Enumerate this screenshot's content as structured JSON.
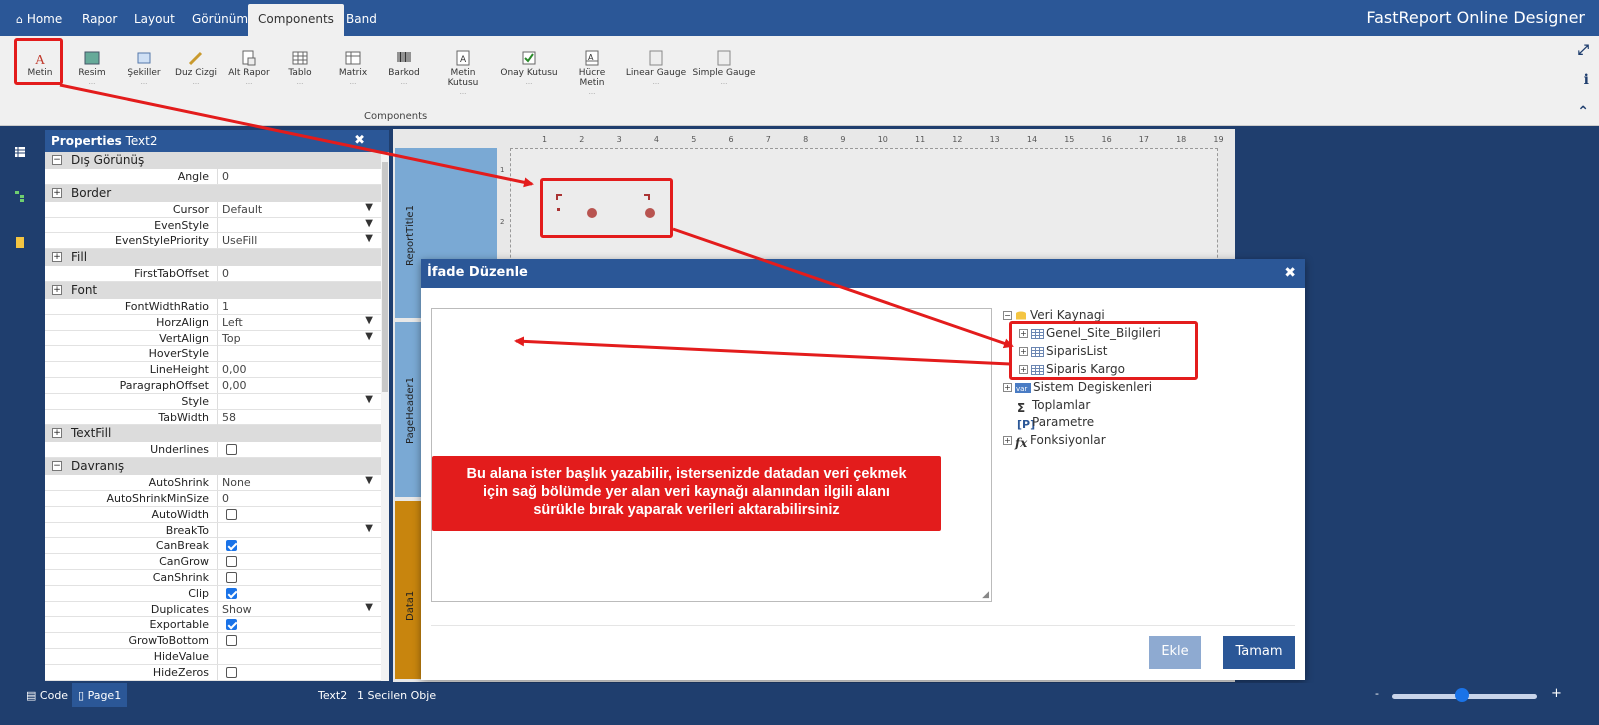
{
  "topbar": {
    "tabs": [
      {
        "label": "Home",
        "icon": "home-icon"
      },
      {
        "label": "Rapor"
      },
      {
        "label": "Layout"
      },
      {
        "label": "Görünüm"
      },
      {
        "label": "Components"
      },
      {
        "label": "Band"
      }
    ],
    "active_tab": "Components",
    "app_title": "FastReport Online Designer"
  },
  "ribbon": {
    "group_label": "Components",
    "items": [
      {
        "label": "Metin",
        "icon": "text-icon"
      },
      {
        "label": "Resim",
        "icon": "picture-icon"
      },
      {
        "label": "Şekiller",
        "icon": "shape-icon"
      },
      {
        "label": "Duz Cizgi",
        "icon": "line-icon"
      },
      {
        "label": "Alt Rapor",
        "icon": "subreport-icon"
      },
      {
        "label": "Tablo",
        "icon": "table-icon"
      },
      {
        "label": "Matrix",
        "icon": "matrix-icon"
      },
      {
        "label": "Barkod",
        "icon": "barcode-icon"
      },
      {
        "label": "Metin Kutusu",
        "icon": "textbox-icon"
      },
      {
        "label": "Onay Kutusu",
        "icon": "checkbox-icon"
      },
      {
        "label": "Hücre Metin",
        "icon": "cell-text-icon"
      },
      {
        "label": "Linear Gauge",
        "icon": "linear-gauge-icon"
      },
      {
        "label": "Simple Gauge",
        "icon": "simple-gauge-icon"
      }
    ],
    "dots": "..."
  },
  "properties": {
    "title": "Properties",
    "object": "Text2",
    "rows": [
      {
        "type": "cat",
        "label": "Dış Görünüş",
        "toggle": "−"
      },
      {
        "type": "prop",
        "name": "Angle",
        "value": "0"
      },
      {
        "type": "cat",
        "label": "Border",
        "toggle": "+"
      },
      {
        "type": "prop",
        "name": "Cursor",
        "value": "Default",
        "dropdown": true
      },
      {
        "type": "prop",
        "name": "EvenStyle",
        "value": "",
        "dropdown": true
      },
      {
        "type": "prop",
        "name": "EvenStylePriority",
        "value": "UseFill",
        "dropdown": true
      },
      {
        "type": "cat",
        "label": "Fill",
        "toggle": "+"
      },
      {
        "type": "prop",
        "name": "FirstTabOffset",
        "value": "0"
      },
      {
        "type": "cat",
        "label": "Font",
        "toggle": "+"
      },
      {
        "type": "prop",
        "name": "FontWidthRatio",
        "value": "1"
      },
      {
        "type": "prop",
        "name": "HorzAlign",
        "value": "Left",
        "dropdown": true
      },
      {
        "type": "prop",
        "name": "VertAlign",
        "value": "Top",
        "dropdown": true
      },
      {
        "type": "prop",
        "name": "HoverStyle",
        "value": ""
      },
      {
        "type": "prop",
        "name": "LineHeight",
        "value": "0,00"
      },
      {
        "type": "prop",
        "name": "ParagraphOffset",
        "value": "0,00"
      },
      {
        "type": "prop",
        "name": "Style",
        "value": "",
        "dropdown": true
      },
      {
        "type": "prop",
        "name": "TabWidth",
        "value": "58"
      },
      {
        "type": "cat",
        "label": "TextFill",
        "toggle": "+"
      },
      {
        "type": "prop",
        "name": "Underlines",
        "checkbox": false
      },
      {
        "type": "cat",
        "label": "Davranış",
        "toggle": "−"
      },
      {
        "type": "prop",
        "name": "AutoShrink",
        "value": "None",
        "dropdown": true
      },
      {
        "type": "prop",
        "name": "AutoShrinkMinSize",
        "value": "0"
      },
      {
        "type": "prop",
        "name": "AutoWidth",
        "checkbox": false
      },
      {
        "type": "prop",
        "name": "BreakTo",
        "value": "",
        "dropdown": true
      },
      {
        "type": "prop",
        "name": "CanBreak",
        "checkbox": true
      },
      {
        "type": "prop",
        "name": "CanGrow",
        "checkbox": false
      },
      {
        "type": "prop",
        "name": "CanShrink",
        "checkbox": false
      },
      {
        "type": "prop",
        "name": "Clip",
        "checkbox": true
      },
      {
        "type": "prop",
        "name": "Duplicates",
        "value": "Show",
        "dropdown": true
      },
      {
        "type": "prop",
        "name": "Exportable",
        "checkbox": true
      },
      {
        "type": "prop",
        "name": "GrowToBottom",
        "checkbox": false
      },
      {
        "type": "prop",
        "name": "HideValue",
        "value": ""
      },
      {
        "type": "prop",
        "name": "HideZeros",
        "checkbox": false
      }
    ]
  },
  "canvas": {
    "ruler": [
      "1",
      "2",
      "3",
      "4",
      "5",
      "6",
      "7",
      "8",
      "9",
      "10",
      "11",
      "12",
      "13",
      "14",
      "15",
      "16",
      "17",
      "18",
      "19"
    ],
    "bands": [
      {
        "label": "ReportTitle1",
        "color": "#7aa9d4"
      },
      {
        "label": "PageHeader1",
        "color": "#7aa9d4"
      },
      {
        "label": "Data1",
        "color": "#c8850e"
      }
    ]
  },
  "dialog": {
    "title": "İfade Düzenle",
    "tree": [
      {
        "label": "Veri Kaynagi",
        "pm": "−",
        "icon": "database-icon",
        "level": 0
      },
      {
        "label": "Genel_Site_Bilgileri",
        "pm": "+",
        "icon": "table-icon",
        "level": 1
      },
      {
        "label": "SiparisList",
        "pm": "+",
        "icon": "table-icon",
        "level": 1
      },
      {
        "label": "Siparis Kargo",
        "pm": "+",
        "icon": "table-icon",
        "level": 1
      },
      {
        "label": "Sistem Degiskenleri",
        "pm": "+",
        "icon": "var-icon",
        "level": 0
      },
      {
        "label": "Toplamlar",
        "pm": "",
        "icon": "sigma-icon",
        "level": 0
      },
      {
        "label": "Parametre",
        "pm": "",
        "icon": "parameter-icon",
        "level": 0
      },
      {
        "label": "Fonksiyonlar",
        "pm": "+",
        "icon": "function-icon",
        "level": 0
      }
    ],
    "buttons": {
      "add": "Ekle",
      "ok": "Tamam"
    }
  },
  "annotation": {
    "callout_lines": [
      "Bu alana ister başlık yazabilir, istersenizde datadan veri çekmek",
      "için sağ bölümde yer alan veri kaynağı alanından ilgili alanı",
      "sürükle bırak yaparak verileri aktarabilirsiniz"
    ],
    "color": "#e31c1c"
  },
  "statusbar": {
    "code_label": "Code",
    "page_label": "Page1",
    "selected_object": "Text2",
    "selection_count": "1 Secilen Obje",
    "zoom_minus": "-",
    "zoom_plus": "+"
  }
}
